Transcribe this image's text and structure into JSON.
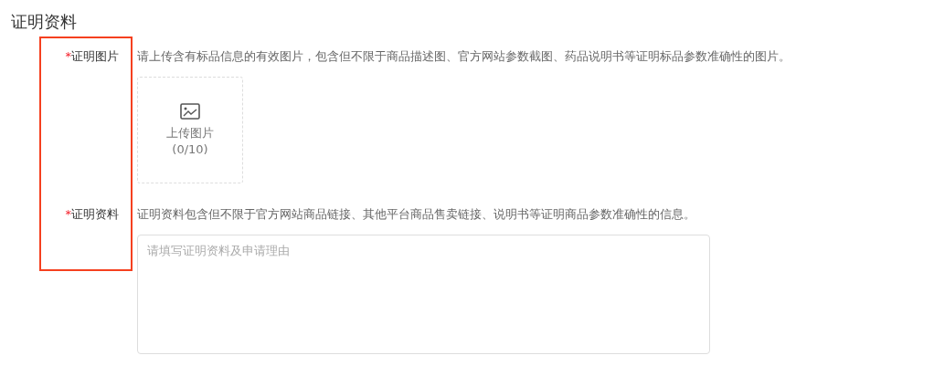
{
  "section_title": "证明资料",
  "fields": [
    {
      "kind": "upload",
      "required_mark": "*",
      "label": "证明图片",
      "hint": "请上传含有标品信息的有效图片，包含但不限于商品描述图、官方网站参数截图、药品说明书等证明标品参数准确性的图片。",
      "upload_label": "上传图片",
      "upload_count": "(0/10)"
    },
    {
      "kind": "textarea",
      "required_mark": "*",
      "label": "证明资料",
      "hint": "证明资料包含但不限于官方网站商品链接、其他平台商品售卖链接、说明书等证明商品参数准确性的信息。",
      "placeholder": "请填写证明资料及申请理由"
    }
  ],
  "highlight": {
    "color": "#f5401f"
  }
}
